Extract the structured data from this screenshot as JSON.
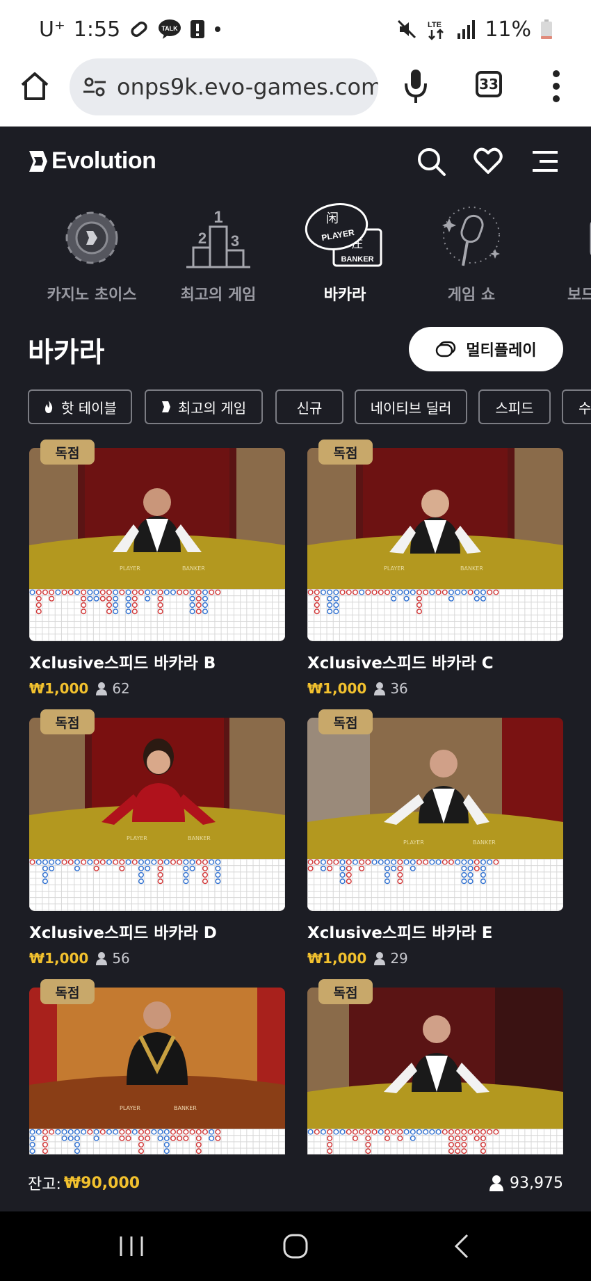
{
  "status_bar": {
    "carrier": "U⁺",
    "time": "1:55",
    "talk_badge": "TALK",
    "network": "LTE",
    "battery": "11%"
  },
  "browser": {
    "url": "onps9k.evo-games.com",
    "tab_count": "33"
  },
  "app": {
    "logo_text": "Evolution"
  },
  "categories": [
    {
      "label": "카지노 초이스",
      "icon": "casino-chip-icon"
    },
    {
      "label": "최고의 게임",
      "icon": "podium-icon",
      "podium": [
        "1",
        "2",
        "3"
      ]
    },
    {
      "label": "바카라",
      "icon": "baccarat-icon",
      "active": true,
      "icon_text": [
        "闲",
        "PLAYER",
        "庄",
        "BANKER"
      ]
    },
    {
      "label": "게임 쇼",
      "icon": "microphone-icon"
    },
    {
      "label": "보드",
      "icon": "dice-icon"
    }
  ],
  "section": {
    "title": "바카라",
    "multiplay_label": "멀티플레이"
  },
  "filters": [
    {
      "label": "핫 테이블",
      "icon": "flame-icon"
    },
    {
      "label": "최고의 게임",
      "icon": "evolution-mark-icon"
    },
    {
      "label": "신규"
    },
    {
      "label": "네이티브 딜러"
    },
    {
      "label": "스피드"
    },
    {
      "label": "수"
    }
  ],
  "games": [
    {
      "badge": "독점",
      "title": "Xclusive스피드 바카라 B",
      "min_bet": "₩1,000",
      "players": "62",
      "table_text": [
        "PLAYER",
        "BANKER"
      ]
    },
    {
      "badge": "독점",
      "title": "Xclusive스피드 바카라 C",
      "min_bet": "₩1,000",
      "players": "36",
      "table_text": [
        "PLAYER",
        "BANKER"
      ]
    },
    {
      "badge": "독점",
      "title": "Xclusive스피드 바카라 D",
      "min_bet": "₩1,000",
      "players": "56",
      "table_text": [
        "PLAYER",
        "BANKER"
      ]
    },
    {
      "badge": "독점",
      "title": "Xclusive스피드 바카라 E",
      "min_bet": "₩1,000",
      "players": "29",
      "table_text": [
        "PLAYER",
        "BANKER"
      ]
    },
    {
      "badge": "독점",
      "table_text": [
        "PLAYER",
        "BANKER"
      ]
    },
    {
      "badge": "독점"
    }
  ],
  "footer": {
    "balance_label": "잔고:",
    "balance_value": "₩90,000",
    "online_count": "93,975"
  },
  "colors": {
    "background": "#1c1d24",
    "accent_gold": "#f2c12e",
    "badge": "#c8a86a",
    "player_blue": "#2d6fd1",
    "banker_red": "#d23434"
  }
}
